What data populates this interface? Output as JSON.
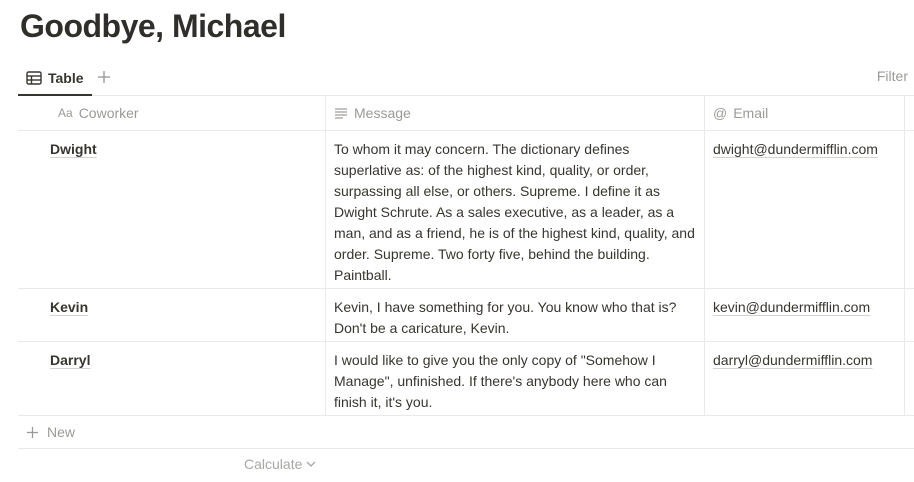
{
  "page": {
    "title": "Goodbye, Michael"
  },
  "views": {
    "active_tab": {
      "label": "Table",
      "icon": "table-icon"
    },
    "add_icon": "plus-icon",
    "filter_label": "Filter"
  },
  "table": {
    "columns": [
      {
        "label": "Coworker",
        "icon": "text-aa",
        "icon_text": "Aa"
      },
      {
        "label": "Message",
        "icon": "lines-icon"
      },
      {
        "label": "Email",
        "icon": "at-icon",
        "icon_text": "@"
      }
    ],
    "rows": [
      {
        "name": "Dwight",
        "message": "To whom it may concern. The dictionary defines superlative as: of the highest kind, quality, or order, surpassing all else, or others. Supreme. I define it as Dwight Schrute. As a sales executive, as a leader, as a man, and as a friend, he is of the highest kind, quality, and order. Supreme. Two forty five, behind the building. Paintball.",
        "email": "dwight@dundermifflin.com"
      },
      {
        "name": "Kevin",
        "message": "Kevin, I have something for you. You know who that is? Don't be a caricature, Kevin.",
        "email": "kevin@dundermifflin.com"
      },
      {
        "name": "Darryl",
        "message": "I would like to give you the only copy of \"Somehow I Manage\", unfinished. If there's anybody here who can finish it, it's you.",
        "email": "darryl@dundermifflin.com"
      }
    ],
    "new_label": "New",
    "calculate_label": "Calculate"
  },
  "colors": {
    "text": "#37352f",
    "muted": "#9b9a97",
    "border": "#e9e9e7"
  }
}
